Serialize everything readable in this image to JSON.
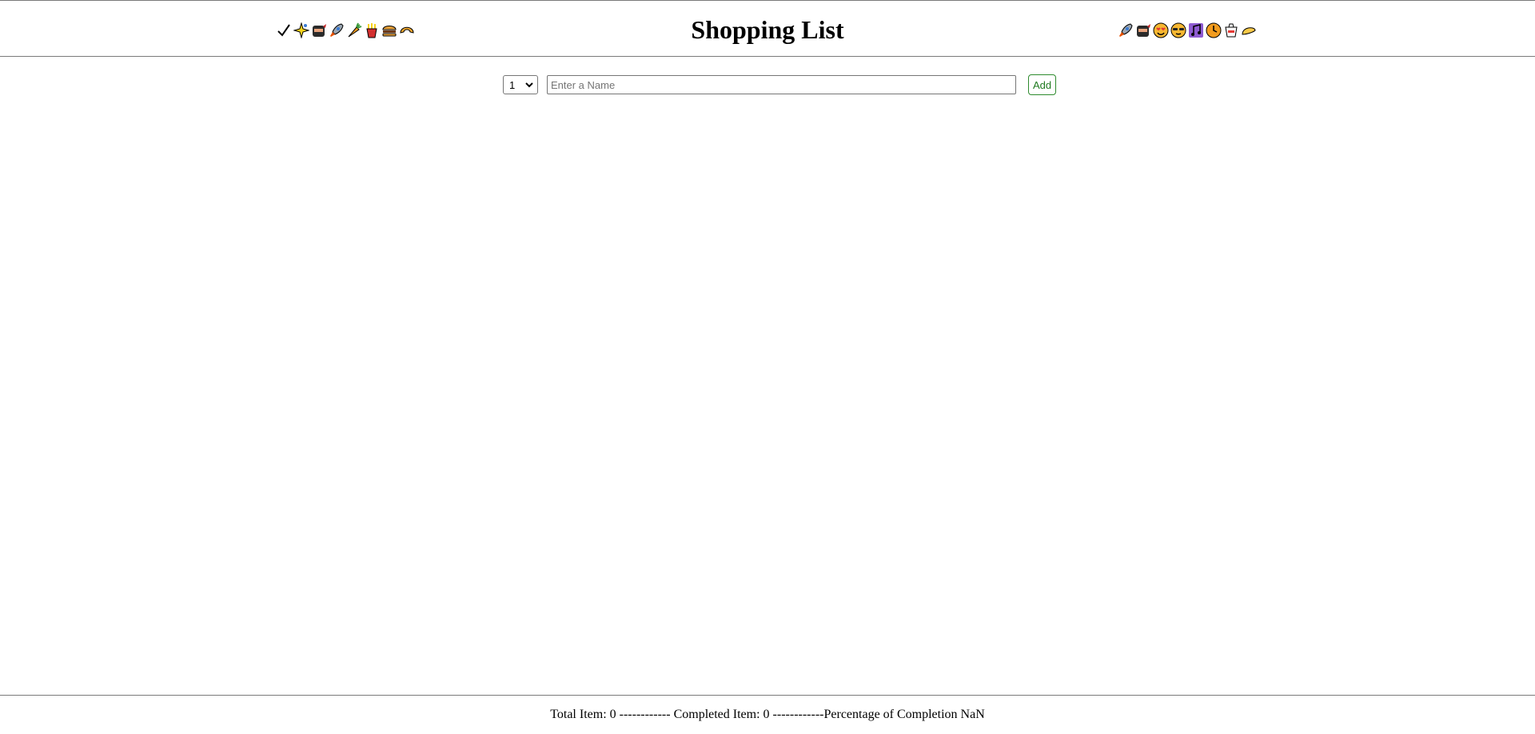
{
  "header": {
    "title": "Shopping List",
    "left_icons": [
      "checkmark-icon",
      "sparkle-icon",
      "ninja-icon",
      "rocket-icon",
      "carrot-icon",
      "fries-icon",
      "burger-icon",
      "croissant-icon"
    ],
    "right_icons": [
      "rocket-icon",
      "ninja-icon",
      "heart-eyes-icon",
      "sunglasses-icon",
      "music-notes-icon",
      "clock-icon",
      "takeout-box-icon",
      "taco-icon"
    ]
  },
  "form": {
    "quantity_value": "1",
    "quantity_options": [
      "1"
    ],
    "name_placeholder": "Enter a Name",
    "name_value": "",
    "add_label": "Add"
  },
  "colors": {
    "add_button": "#1f7a1f",
    "border": "#7a7a7a"
  },
  "footer": {
    "stats_text": "Total Item: 0 ------------ Completed Item: 0 ------------Percentage of Completion NaN"
  }
}
